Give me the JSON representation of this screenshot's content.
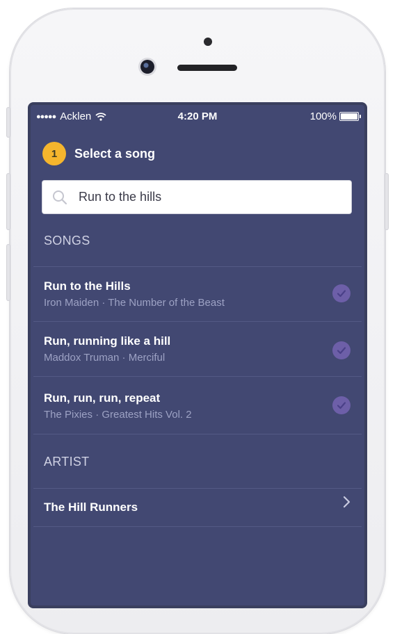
{
  "status_bar": {
    "signal": "●●●●●",
    "carrier": "Acklen",
    "time": "4:20 PM",
    "battery_percent": "100%",
    "battery_level": 1.0
  },
  "step": {
    "number": "1",
    "title": "Select a song"
  },
  "search": {
    "value": "Run to the hills",
    "icon": "search-icon"
  },
  "sections": {
    "songs_label": "SONGS",
    "artist_label": "ARTIST"
  },
  "songs": [
    {
      "title": "Run to the Hills",
      "subtitle": "Iron Maiden · The Number of the Beast"
    },
    {
      "title": "Run, running like a hill",
      "subtitle": "Maddox Truman · Merciful"
    },
    {
      "title": "Run, run, run, repeat",
      "subtitle": "The Pixies · Greatest Hits Vol. 2"
    }
  ],
  "artists": [
    {
      "name": "The Hill Runners"
    }
  ],
  "colors": {
    "screen_bg": "#424872",
    "accent_badge": "#f5b52d",
    "check": "#6d5fa8"
  }
}
